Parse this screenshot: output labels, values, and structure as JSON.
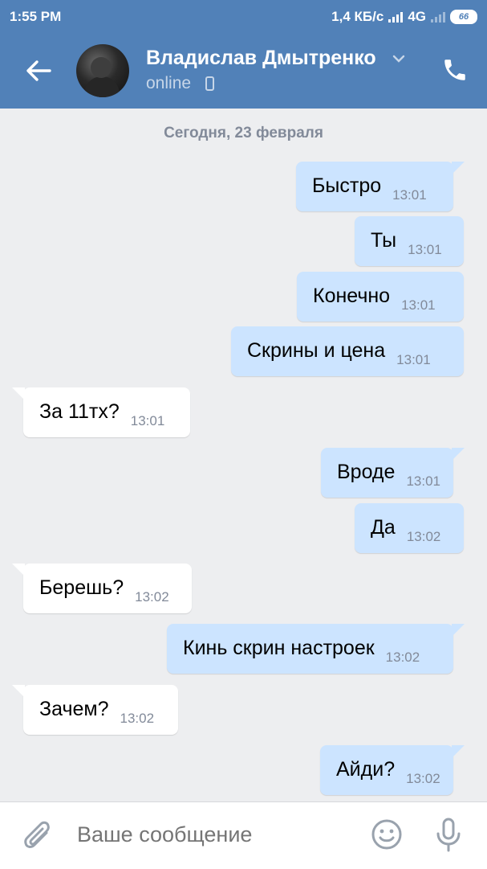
{
  "statusbar": {
    "time": "1:55 PM",
    "network_speed": "1,4 КБ/с",
    "network_type": "4G",
    "battery": "66"
  },
  "header": {
    "contact_name": "Владислав Дмытренко",
    "presence": "online"
  },
  "chat": {
    "date_separator": "Сегодня, 23 февраля",
    "messages": [
      {
        "dir": "out",
        "text": "Быстро",
        "time": "13:01"
      },
      {
        "dir": "out",
        "text": "Ты",
        "time": "13:01"
      },
      {
        "dir": "out",
        "text": "Конечно",
        "time": "13:01"
      },
      {
        "dir": "out",
        "text": "Скрины и цена",
        "time": "13:01"
      },
      {
        "dir": "in",
        "text": "За 11тх?",
        "time": "13:01"
      },
      {
        "dir": "out",
        "text": "Вроде",
        "time": "13:01"
      },
      {
        "dir": "out",
        "text": "Да",
        "time": "13:02"
      },
      {
        "dir": "in",
        "text": "Берешь?",
        "time": "13:02"
      },
      {
        "dir": "out",
        "text": "Кинь скрин настроек",
        "time": "13:02"
      },
      {
        "dir": "in",
        "text": "Зачем?",
        "time": "13:02"
      },
      {
        "dir": "out",
        "text": "Айди?",
        "time": "13:02"
      }
    ]
  },
  "composer": {
    "placeholder": "Ваше сообщение"
  },
  "icons": {
    "back": "arrow-left-icon",
    "dropdown": "chevron-down-icon",
    "mobile": "mobile-phone-icon",
    "call": "phone-icon",
    "attach": "paperclip-icon",
    "emoji": "smile-icon",
    "voice": "microphone-icon"
  },
  "colors": {
    "header": "#5181b8",
    "outgoing_bubble": "#cce4ff",
    "incoming_bubble": "#ffffff",
    "background": "#edeef0"
  }
}
